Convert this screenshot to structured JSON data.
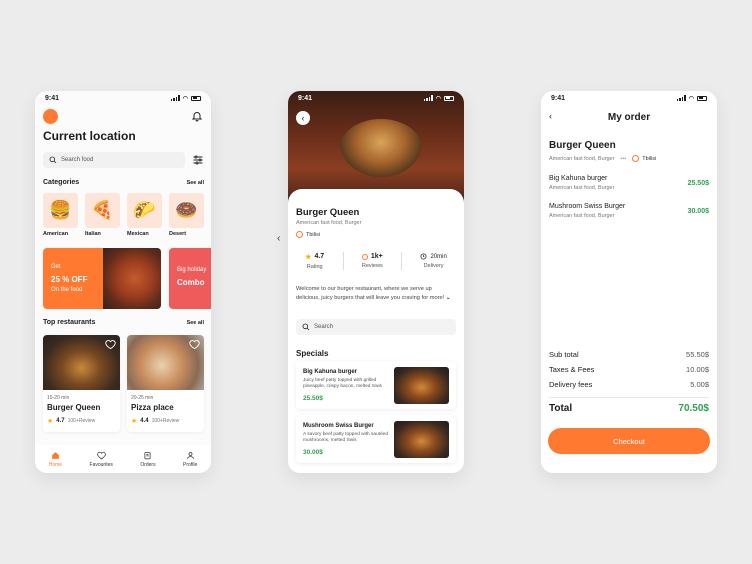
{
  "screen1": {
    "time": "9:41",
    "title": "Current location",
    "search_placeholder": "Search food",
    "categories_title": "Categories",
    "categories_see_all": "See all",
    "categories": [
      {
        "label": "American",
        "icon": "burger-icon",
        "glyph": "🍔"
      },
      {
        "label": "Italian",
        "icon": "pizza-icon",
        "glyph": "🍕"
      },
      {
        "label": "Mexican",
        "icon": "taco-icon",
        "glyph": "🌮"
      },
      {
        "label": "Desert",
        "icon": "donut-icon",
        "glyph": "🍩"
      }
    ],
    "promo1": {
      "line1": "Get",
      "line2": "25 % OFF",
      "line3": "On the food"
    },
    "promo2": {
      "line1": "Big holiday",
      "line2": "Combo"
    },
    "restaurants_title": "Top restaurants",
    "restaurants_see_all": "See all",
    "restaurants": [
      {
        "time": "15-20 min",
        "name": "Burger Queen",
        "rating": "4.7",
        "reviews": "100+Review"
      },
      {
        "time": "20-25 min",
        "name": "Pizza place",
        "rating": "4.4",
        "reviews": "100+Review"
      }
    ],
    "tabs": [
      "Home",
      "Favourites",
      "Orders",
      "Profile"
    ],
    "accent": "#ff7a30"
  },
  "screen2": {
    "time": "9:41",
    "name": "Burger Queen",
    "cuisine": "American fast food, Burger",
    "location": "Tbilisi",
    "stats": [
      {
        "value": "4.7",
        "label": "Rating"
      },
      {
        "value": "1k+",
        "label": "Reviews"
      },
      {
        "value": "20min",
        "label": "Delivery"
      }
    ],
    "description": "Welcome to our burger restaurant, where we serve up delicious, juicy burgers that will leave you craving for more!",
    "search_placeholder": "Search",
    "specials_title": "Specials",
    "specials": [
      {
        "name": "Big Kahuna burger",
        "desc": "Juicy beef patty topped with grilled pineapple, crispy bacon, melted Swis",
        "price": "25.50$"
      },
      {
        "name": "Mushroom Swiss Burger",
        "desc": "A savory beef patty topped with sautéed mushrooms, melted Swis",
        "price": "30.00$"
      }
    ]
  },
  "screen3": {
    "time": "9:41",
    "title": "My order",
    "restaurant": "Burger Queen",
    "cuisine": "American fast food, Burger",
    "location": "Tbilisi",
    "items": [
      {
        "name": "Big Kahuna burger",
        "sub": "American fast food, Burger",
        "price": "25.50$"
      },
      {
        "name": "Mushroom Swiss Burger",
        "sub": "American fast food, Burger",
        "price": "30.00$"
      }
    ],
    "subtotal_label": "Sub total",
    "subtotal": "55.50$",
    "taxes_label": "Taxes & Fees",
    "taxes": "10.00$",
    "delivery_label": "Delivery fees",
    "delivery": "5.00$",
    "total_label": "Total",
    "total": "70.50$",
    "checkout_label": "Checkout",
    "price_color": "#2ea14f"
  }
}
